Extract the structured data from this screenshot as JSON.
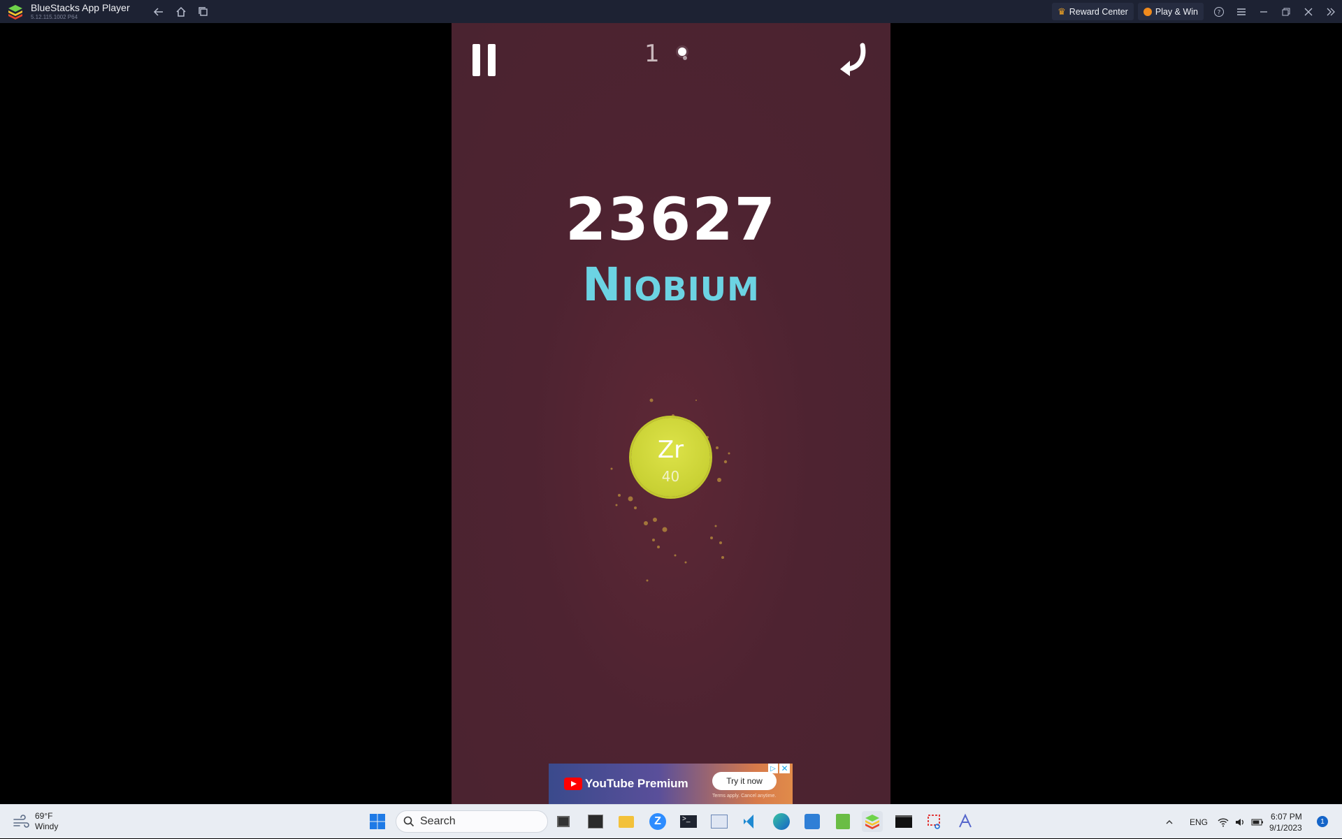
{
  "window": {
    "title": "BlueStacks App Player",
    "version": "5.12.115.1002  P64",
    "reward_center": "Reward Center",
    "play_win": "Play & Win"
  },
  "game": {
    "counter": "1",
    "score": "23627",
    "element_name": "Niobium",
    "atom": {
      "symbol": "Zr",
      "number": "40",
      "color": "#cdd43a"
    },
    "background": "#4e2331",
    "name_color": "#6cd3e3"
  },
  "ad": {
    "brand": "YouTube Premium",
    "cta": "Try it now",
    "terms": "Terms apply. Cancel anytime."
  },
  "taskbar": {
    "weather_temp": "69°F",
    "weather_desc": "Windy",
    "search_placeholder": "Search",
    "lang": "ENG",
    "time": "6:07 PM",
    "date": "9/1/2023",
    "notifications": "1",
    "apps": [
      "file-manager-icon",
      "media-icon",
      "folder-icon",
      "zoom-icon",
      "terminal-icon",
      "photos-icon",
      "vscode-icon",
      "edge-icon",
      "paint-icon",
      "notepad-icon",
      "bluestacks-icon",
      "cmd-icon",
      "snip-icon",
      "editor-icon"
    ]
  }
}
